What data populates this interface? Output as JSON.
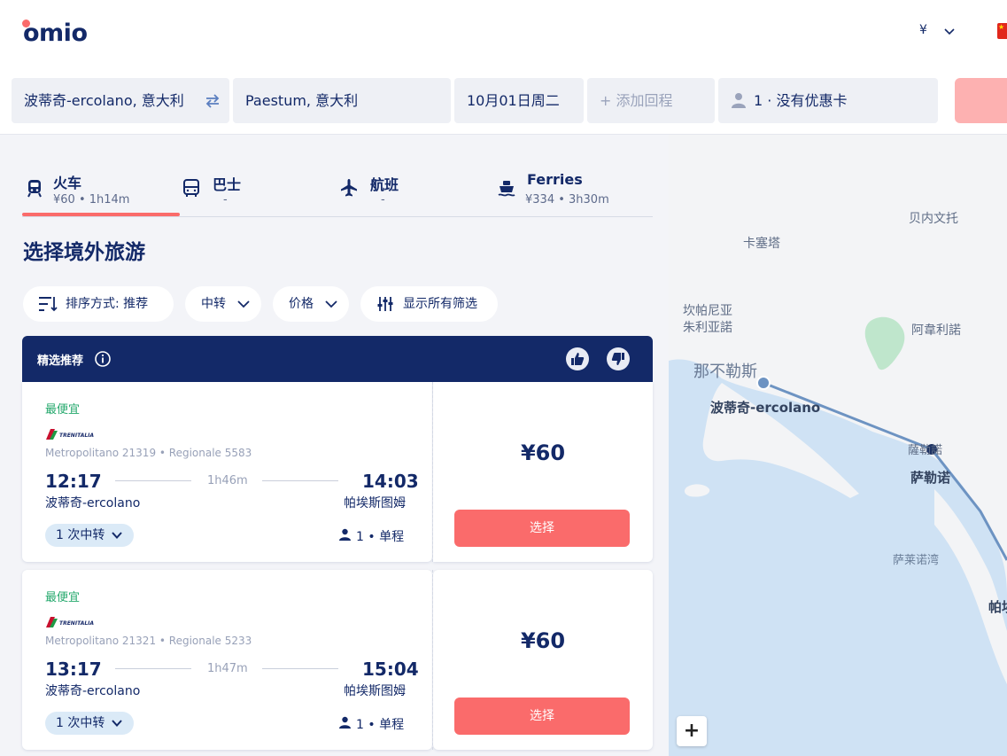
{
  "header": {
    "logo": "omio",
    "currency": "¥"
  },
  "search": {
    "origin": "波蒂奇-ercolano, 意大利",
    "destination": "Paestum, 意大利",
    "date": "10月01日周二",
    "return_placeholder": "+ 添加回程",
    "passengers": "1 · 没有优惠卡"
  },
  "tabs": [
    {
      "label": "火车",
      "sub": "¥60 • 1h14m",
      "icon": "train-icon",
      "active": true
    },
    {
      "label": "巴士",
      "sub": "-",
      "icon": "bus-icon",
      "active": false
    },
    {
      "label": "航班",
      "sub": "-",
      "icon": "plane-icon",
      "active": false
    },
    {
      "label": "Ferries",
      "sub": "¥334 • 3h30m",
      "icon": "ferry-icon",
      "active": false
    }
  ],
  "page_title": "选择境外旅游",
  "filters": {
    "sort": "排序方式: 推荐",
    "transfers": "中转",
    "price": "价格",
    "all_filters": "显示所有筛选"
  },
  "featured": {
    "label": "精选推荐"
  },
  "results": [
    {
      "badge": "最便宜",
      "service": "Metropolitano 21319 • Regionale 5583",
      "depart": "12:17",
      "arrive": "14:03",
      "duration": "1h46m",
      "from": "波蒂奇-ercolano",
      "to": "帕埃斯图姆",
      "transfers": "1 次中转",
      "pax": "1  •  单程",
      "price": "¥60",
      "select": "选择"
    },
    {
      "badge": "最便宜",
      "service": "Metropolitano 21321 • Regionale 5233",
      "depart": "13:17",
      "arrive": "15:04",
      "duration": "1h47m",
      "from": "波蒂奇-ercolano",
      "to": "帕埃斯图姆",
      "transfers": "1 次中转",
      "pax": "1  •  单程",
      "price": "¥60",
      "select": "选择"
    }
  ],
  "map": {
    "labels": {
      "benevento": "贝内文托",
      "caserta": "卡塞塔",
      "campania": "坎帕尼亚\n朱利亚諾",
      "avellino": "阿韋利諾",
      "naples": "那不勒斯",
      "ercolano": "波蒂奇-ercolano",
      "salerno_small": "薩勒諾",
      "salerno": "萨勒诺",
      "gulf": "萨莱诺湾",
      "paestum_partial": "帕埃"
    },
    "zoom_in": "+"
  },
  "colors": {
    "navy": "#132968",
    "coral": "#fa6b6b",
    "green": "#24a86c",
    "map_water": "#cfe2f4",
    "route": "#6d93c2"
  }
}
